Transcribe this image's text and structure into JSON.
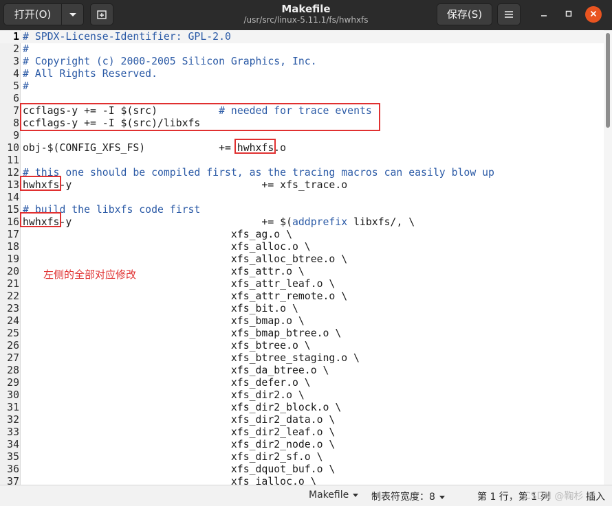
{
  "header": {
    "open_label": "打开(O)",
    "title": "Makefile",
    "path": "/usr/src/linux-5.11.1/fs/hwhxfs",
    "save_label": "保存(S)",
    "icons": {
      "dropdown": "chevron-down-icon",
      "new_tab": "new-tab-icon",
      "menu": "hamburger-menu-icon",
      "minimize": "minimize-icon",
      "maximize": "maximize-icon",
      "close": "close-icon"
    }
  },
  "editor": {
    "current_line": 1,
    "lines": [
      {
        "n": "1",
        "code": "# SPDX-License-Identifier: GPL-2.0",
        "type": "comment"
      },
      {
        "n": "2",
        "code": "#",
        "type": "comment"
      },
      {
        "n": "3",
        "code": "# Copyright (c) 2000-2005 Silicon Graphics, Inc.",
        "type": "comment"
      },
      {
        "n": "4",
        "code": "# All Rights Reserved.",
        "type": "comment"
      },
      {
        "n": "5",
        "code": "#",
        "type": "comment"
      },
      {
        "n": "6",
        "code": "",
        "type": "code"
      },
      {
        "n": "7",
        "code": "ccflags-y += -I $(src)",
        "comment": "# needed for trace events",
        "type": "code"
      },
      {
        "n": "8",
        "code": "ccflags-y += -I $(src)/libxfs",
        "type": "code"
      },
      {
        "n": "9",
        "code": "",
        "type": "code"
      },
      {
        "n": "10",
        "code": "obj-$(CONFIG_XFS_FS)            += hwhxfs.o",
        "type": "code"
      },
      {
        "n": "11",
        "code": "",
        "type": "code"
      },
      {
        "n": "12",
        "code": "# this one should be compiled first, as the tracing macros can easily blow up",
        "type": "comment"
      },
      {
        "n": "13",
        "code": "hwhxfs-y                               += xfs_trace.o",
        "type": "code"
      },
      {
        "n": "14",
        "code": "",
        "type": "code"
      },
      {
        "n": "15",
        "code": "# build the libxfs code first",
        "type": "comment"
      },
      {
        "n": "16",
        "code": "hwhxfs-y                               += $(",
        "func": "addprefix",
        "rest": " libxfs/, \\",
        "type": "func"
      },
      {
        "n": "17",
        "code": "                                  xfs_ag.o \\",
        "type": "code"
      },
      {
        "n": "18",
        "code": "                                  xfs_alloc.o \\",
        "type": "code"
      },
      {
        "n": "19",
        "code": "                                  xfs_alloc_btree.o \\",
        "type": "code"
      },
      {
        "n": "20",
        "code": "                                  xfs_attr.o \\",
        "type": "code"
      },
      {
        "n": "21",
        "code": "                                  xfs_attr_leaf.o \\",
        "type": "code"
      },
      {
        "n": "22",
        "code": "                                  xfs_attr_remote.o \\",
        "type": "code"
      },
      {
        "n": "23",
        "code": "                                  xfs_bit.o \\",
        "type": "code"
      },
      {
        "n": "24",
        "code": "                                  xfs_bmap.o \\",
        "type": "code"
      },
      {
        "n": "25",
        "code": "                                  xfs_bmap_btree.o \\",
        "type": "code"
      },
      {
        "n": "26",
        "code": "                                  xfs_btree.o \\",
        "type": "code"
      },
      {
        "n": "27",
        "code": "                                  xfs_btree_staging.o \\",
        "type": "code"
      },
      {
        "n": "28",
        "code": "                                  xfs_da_btree.o \\",
        "type": "code"
      },
      {
        "n": "29",
        "code": "                                  xfs_defer.o \\",
        "type": "code"
      },
      {
        "n": "30",
        "code": "                                  xfs_dir2.o \\",
        "type": "code"
      },
      {
        "n": "31",
        "code": "                                  xfs_dir2_block.o \\",
        "type": "code"
      },
      {
        "n": "32",
        "code": "                                  xfs_dir2_data.o \\",
        "type": "code"
      },
      {
        "n": "33",
        "code": "                                  xfs_dir2_leaf.o \\",
        "type": "code"
      },
      {
        "n": "34",
        "code": "                                  xfs_dir2_node.o \\",
        "type": "code"
      },
      {
        "n": "35",
        "code": "                                  xfs_dir2_sf.o \\",
        "type": "code"
      },
      {
        "n": "36",
        "code": "                                  xfs_dquot_buf.o \\",
        "type": "code"
      },
      {
        "n": "37",
        "code": "                                  xfs_ialloc.o \\",
        "type": "code"
      }
    ]
  },
  "annotation": {
    "note": "左侧的全部对应修改",
    "color": "#e03030"
  },
  "statusbar": {
    "language": "Makefile",
    "tab_width": "制表符宽度：8",
    "position": "第 1 行，第 1 列",
    "insert_mode": "插入",
    "watermark": "CSDN @鞠杉"
  },
  "colors": {
    "titlebar": "#2b2b2b",
    "close_button": "#e95420",
    "comment": "#2b5aa6"
  }
}
